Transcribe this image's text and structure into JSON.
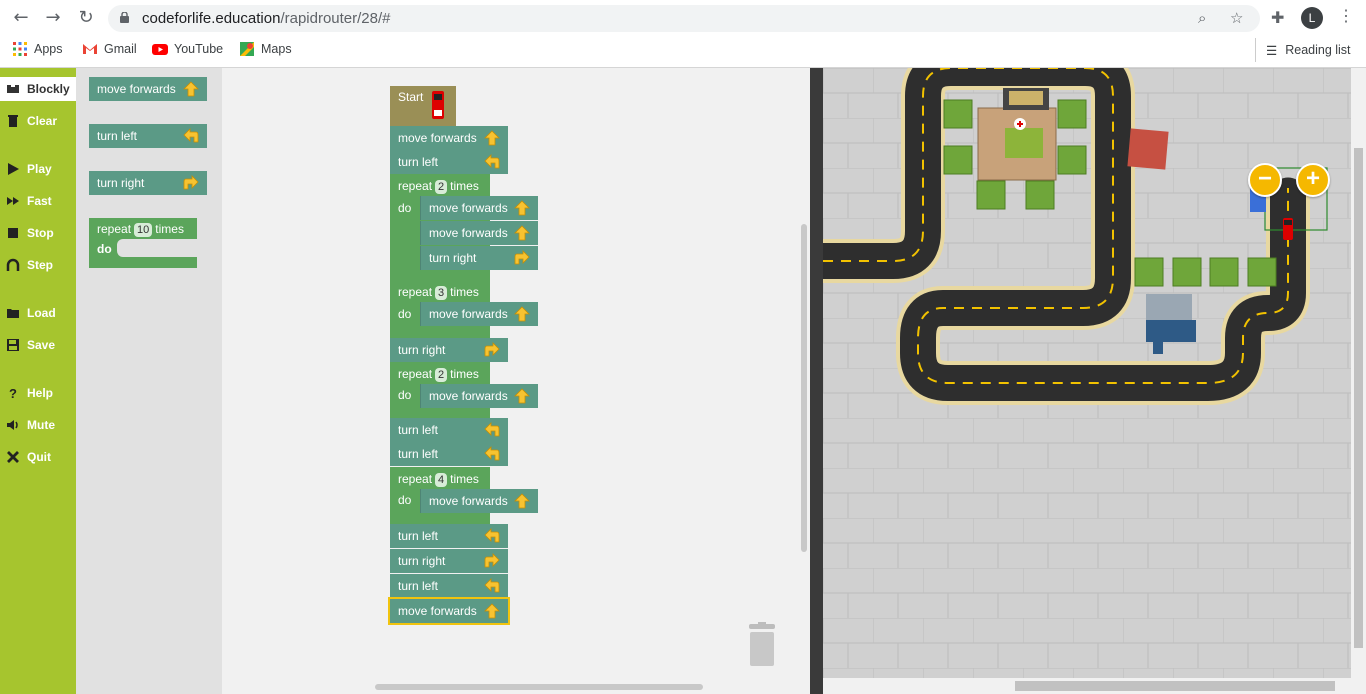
{
  "browser": {
    "url_host": "codeforlife.education",
    "url_path": "/rapidrouter/28/#",
    "avatar_letter": "L",
    "bookmarks": [
      {
        "label": "Apps",
        "icon": "apps-grid-icon"
      },
      {
        "label": "Gmail",
        "icon": "gmail-icon"
      },
      {
        "label": "YouTube",
        "icon": "youtube-icon"
      },
      {
        "label": "Maps",
        "icon": "maps-icon"
      }
    ],
    "reading_list": "Reading list"
  },
  "sidebar": {
    "items": [
      {
        "label": "Blockly",
        "icon": "blockly-icon",
        "active": true
      },
      {
        "label": "Clear",
        "icon": "trash-icon"
      },
      {
        "label": "Play",
        "icon": "play-icon"
      },
      {
        "label": "Fast",
        "icon": "fast-forward-icon"
      },
      {
        "label": "Stop",
        "icon": "stop-icon"
      },
      {
        "label": "Step",
        "icon": "step-icon"
      },
      {
        "label": "Load",
        "icon": "folder-icon"
      },
      {
        "label": "Save",
        "icon": "save-icon"
      },
      {
        "label": "Help",
        "icon": "help-icon"
      },
      {
        "label": "Mute",
        "icon": "speaker-icon"
      },
      {
        "label": "Quit",
        "icon": "close-icon"
      }
    ]
  },
  "toolbox": {
    "move_forwards": "move forwards",
    "turn_left": "turn left",
    "turn_right": "turn right",
    "repeat_label": "repeat",
    "repeat_count": "10",
    "times_label": "times",
    "do_label": "do"
  },
  "program": {
    "start": "Start",
    "repeat": "repeat",
    "times": "times",
    "do": "do",
    "blocks": [
      "move forwards",
      "turn left",
      "2",
      "move forwards",
      "move forwards",
      "turn right",
      "3",
      "move forwards",
      "turn right",
      "2",
      "move forwards",
      "turn left",
      "turn left",
      "4",
      "move forwards",
      "turn left",
      "turn right",
      "turn left",
      "move forwards"
    ]
  },
  "game": {
    "zoom_out": "−",
    "zoom_in": "+"
  },
  "colors": {
    "sidebar": "#a6c52e",
    "block_green": "#5ba55b",
    "block_teal": "#5b9a86",
    "start_block": "#9a8f56",
    "zoom_button": "#f5b800"
  }
}
